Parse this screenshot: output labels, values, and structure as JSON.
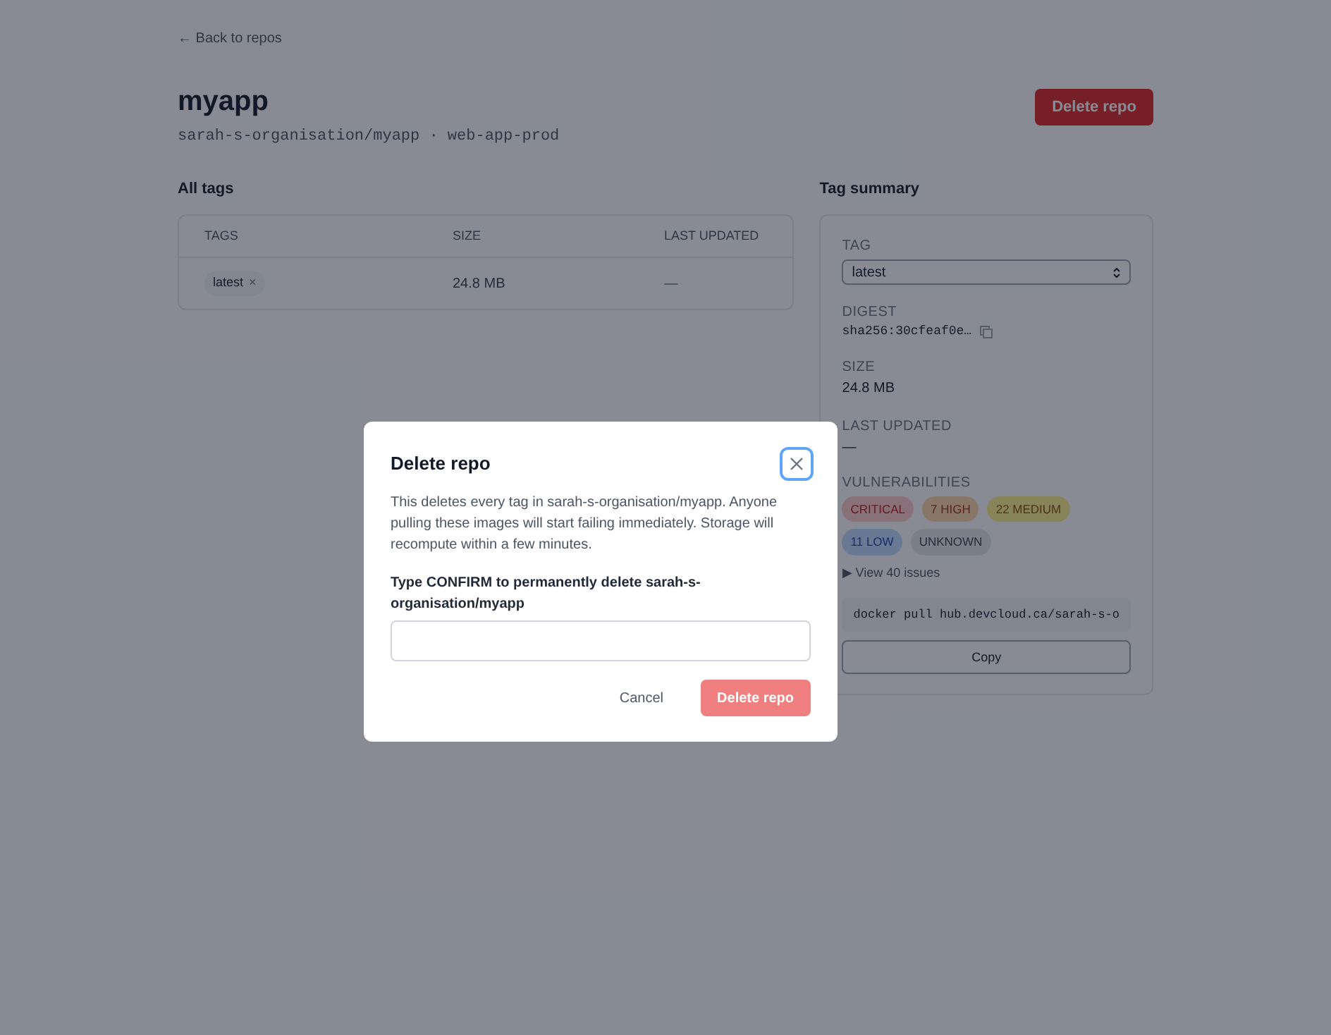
{
  "back_link": "← Back to repos",
  "repo": {
    "name": "myapp",
    "path": "sarah-s-organisation/myapp · web-app-prod",
    "delete_button": "Delete repo"
  },
  "all_tags": {
    "title": "All tags",
    "columns": [
      "TAGS",
      "SIZE",
      "LAST UPDATED"
    ],
    "rows": [
      {
        "tag": "latest",
        "remove": "×",
        "size": "24.8 MB",
        "last_updated": "—"
      }
    ]
  },
  "tag_summary": {
    "title": "Tag summary",
    "tag_label": "TAG",
    "tag_value": "latest",
    "digest_label": "DIGEST",
    "digest": "sha256:30cfeaf0e…",
    "size_label": "SIZE",
    "size": "24.8 MB",
    "updated_label": "LAST UPDATED",
    "updated": "—",
    "vuln_label": "VULNERABILITIES",
    "vulnerabilities": [
      {
        "label": "CRITICAL",
        "kind": "critical"
      },
      {
        "label": "7 HIGH",
        "kind": "high"
      },
      {
        "label": "22 MEDIUM",
        "kind": "medium"
      },
      {
        "label": "11 LOW",
        "kind": "low"
      },
      {
        "label": "UNKNOWN",
        "kind": "unknown"
      }
    ],
    "issues_toggle": "▶ View 40 issues",
    "expanded": false,
    "pull_command": "docker pull hub.devcloud.ca/sarah-s-o",
    "copy_button": "Copy"
  },
  "dialog": {
    "title": "Delete repo",
    "close_focused": true,
    "message": "This deletes every tag in sarah-s-organisation/myapp. Anyone pulling these images will start failing immediately. Storage will recompute within a few minutes.",
    "field_label": "Type CONFIRM to permanently delete sarah-s-organisation/myapp",
    "cancel": "Cancel",
    "confirm": "Delete repo",
    "confirm_disabled": true
  }
}
